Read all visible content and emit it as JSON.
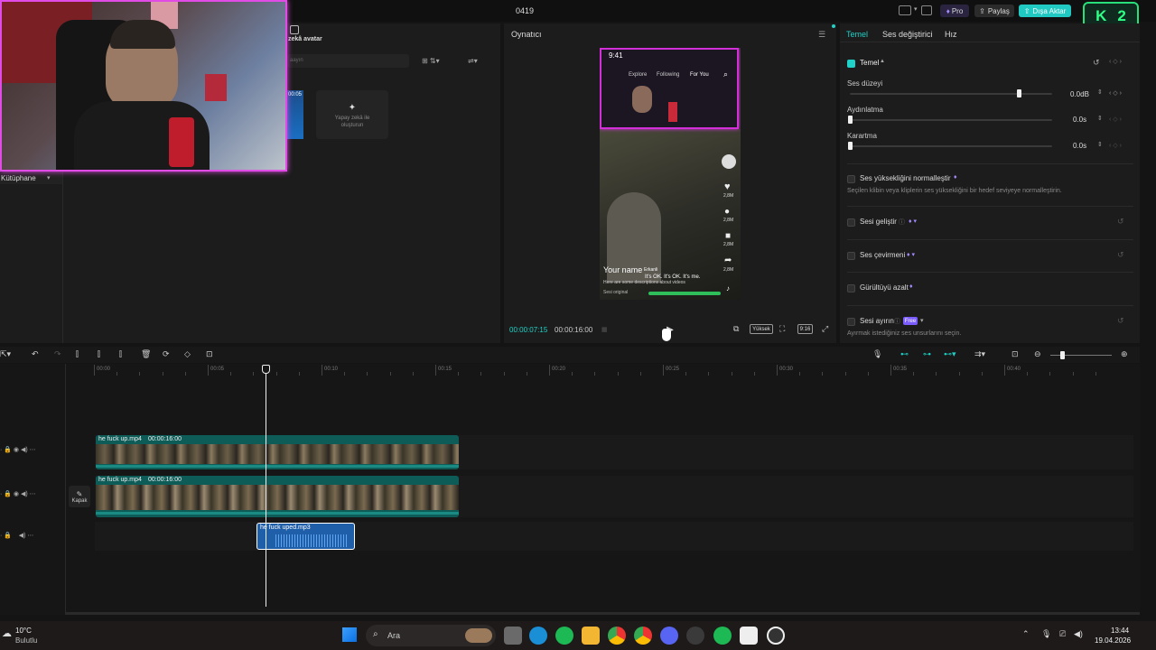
{
  "window": {
    "title": "0419"
  },
  "header": {
    "pro_label": "Pro",
    "share_label": "Paylaş",
    "export_label": "Dışa Aktar",
    "badge_text": "2",
    "badge_letter": "K"
  },
  "media": {
    "avatar_label": "zekâ avatar",
    "search_placeholder": "aayın",
    "clip_time": "00:05",
    "ai_create_label": "Yapay zekâ ile oluşturun",
    "library_label": "Kütüphane"
  },
  "player": {
    "title": "Oynatıcı",
    "current_time": "00:00:07:15",
    "total_time": "00:00:16:00",
    "quality_label": "Yüksek",
    "ratio_label": "9:16",
    "phone": {
      "status_time": "9:41",
      "tabs": [
        "Explore",
        "Following",
        "For You"
      ],
      "counts": [
        "2,8M",
        "2,8M",
        "2,8M",
        "2,8M"
      ],
      "name": "Your name",
      "subtitle1": "It's OK. It's OK. It's me.",
      "subtitle2": "Here are some descriptions about videos",
      "sound": "Sesi original",
      "caption_tag": "Erkanli"
    }
  },
  "inspector": {
    "tabs": [
      "Temel",
      "Ses değiştirici",
      "Hız"
    ],
    "section": "Temel",
    "volume": {
      "label": "Ses düzeyi",
      "value": "0.0dB",
      "level": 0.85
    },
    "fadein": {
      "label": "Aydınlatma",
      "value": "0.0s",
      "level": 0
    },
    "fadeout": {
      "label": "Karartma",
      "value": "0.0s",
      "level": 0
    },
    "normalize": {
      "label": "Ses yüksekliğini normalleştir",
      "desc": "Seçilen klibin veya kliplerin ses yüksekliğini bir hedef seviyeye normalleştirin."
    },
    "enhance": {
      "label": "Sesi geliştir"
    },
    "voice": {
      "label": "Ses çevirmeni"
    },
    "noise": {
      "label": "Gürültüyü azalt"
    },
    "separate": {
      "label": "Sesi ayırın",
      "badge": "Free",
      "desc": "Ayırmak istediğiniz ses unsurlarını seçin."
    }
  },
  "timeline": {
    "ruler": [
      "00:00",
      "00:05",
      "00:10",
      "00:15",
      "00:20",
      "00:25",
      "00:30",
      "00:35",
      "00:40"
    ],
    "tracks": [
      {
        "name": "he fuck up.mp4",
        "duration": "00:00:16:00"
      },
      {
        "name": "he fuck up.mp4",
        "duration": "00:00:16:00"
      }
    ],
    "audio": {
      "name": "he fuck uped.mp3"
    },
    "cover_label": "Kapak"
  },
  "taskbar": {
    "temp": "10°C",
    "weather": "Bulutlu",
    "search": "Ara",
    "time": "13:44",
    "date": "19.04.2026"
  },
  "colors": {
    "accent": "#1fd1c7",
    "export": "#20c9c2",
    "pro": "#7b5cff",
    "clip": "#0e5c58",
    "audio": "#1f5ea8"
  }
}
